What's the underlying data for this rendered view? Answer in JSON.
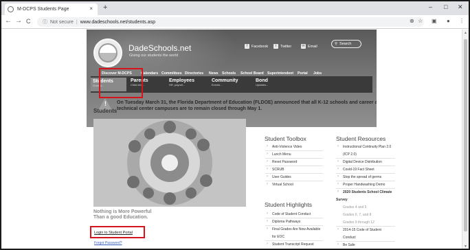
{
  "browser": {
    "tab_title": "M-DCPS Students Page",
    "tab_close": "×",
    "new_tab": "+",
    "win_min": "–",
    "win_max": "□",
    "win_close": "✕",
    "back": "←",
    "forward": "→",
    "reload": "C",
    "info_icon": "ⓘ",
    "security_label": "Not secure",
    "separator": "|",
    "url": "www.dadeschools.net/students.asp",
    "zoom_icon": "⊕",
    "star_icon": "☆",
    "ext_icon": "▣",
    "account_icon": "●",
    "menu_icon": "⋮"
  },
  "header": {
    "brand": "DadeSchools.net",
    "tagline": "Giving our students the world",
    "social": [
      "Facebook",
      "Twitter",
      "Email"
    ],
    "search_label": "Search",
    "search_icon": "⚲",
    "menu": [
      "Discover M-DCPS",
      "Calendars",
      "Committees",
      "Directories",
      "News",
      "Schools",
      "School Board",
      "Superintendent",
      "Portal",
      "Jobs"
    ],
    "subnav": [
      {
        "label": "Students",
        "sub": "Grades..."
      },
      {
        "label": "Parents",
        "sub": "Child info..."
      },
      {
        "label": "Employees",
        "sub": "HR, payroll..."
      },
      {
        "label": "Community",
        "sub": "Events..."
      },
      {
        "label": "Bond",
        "sub": "Updates..."
      }
    ]
  },
  "alert": {
    "text": "On Tuesday March 31, the Florida Department of Education (FLDOE) announced that all K-12 schools and career and technical center campuses are to remain closed through May 1.",
    "icon": "!"
  },
  "students": {
    "title": "Students",
    "motto_line1": "Nothing is More Powerful",
    "motto_line2": "Than a good Education.",
    "login": "Login to Student Portal",
    "forgot": "Forgot Password?"
  },
  "toolbox": {
    "title": "Student Toolbox",
    "items": [
      "Anti-Violence Video",
      "Lunch Menu",
      "Reset Password",
      "SCRUB",
      "User Guides",
      "Virtual School"
    ]
  },
  "highlights": {
    "title": "Student Highlights",
    "items": [
      "Code of Student Conduct",
      "Diploma Pathways",
      "Final Grades Are Now Available",
      "for EOC",
      "Student Transcript Request"
    ]
  },
  "resources": {
    "title": "Student Resources",
    "items": [
      "Instructional Continuity Plan 2.0",
      "(ICP 2.0)",
      "Digital Device Distribution",
      "Covid-19 Fact Sheet",
      "Stop the spread of germs",
      "Proper Handwashing Demo",
      "2020 Students School Climate",
      "Survey",
      "Grades 4 and 5",
      "Grades 6, 7, and 8",
      "Grades 9 through 12",
      "2014-15 Code of Student",
      "Conduct",
      "Be Safe"
    ]
  },
  "colors": {
    "highlight_box": "#d6121a",
    "header_gray": "#6e6e6e",
    "subnav_bg": "#3a3a3a"
  }
}
